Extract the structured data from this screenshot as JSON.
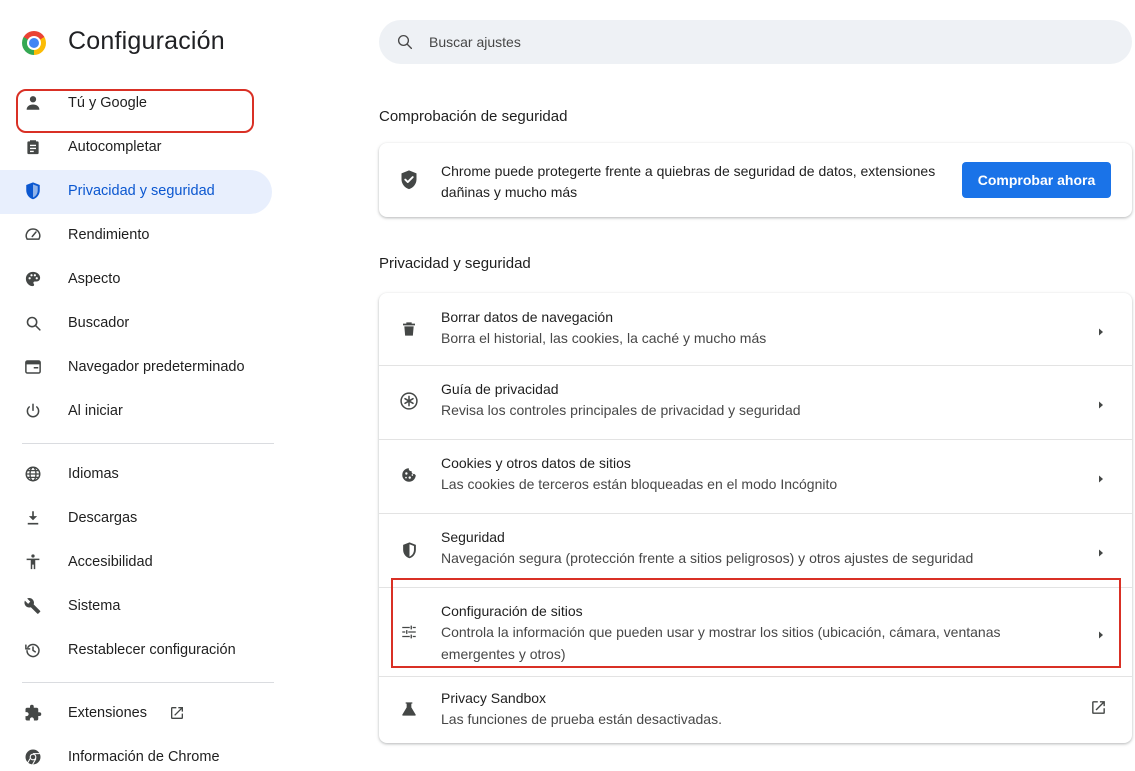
{
  "app": {
    "title": "Configuración"
  },
  "search": {
    "placeholder": "Buscar ajustes",
    "value": ""
  },
  "sidebar": {
    "items": [
      {
        "label": "Tú y Google",
        "icon": "person-icon"
      },
      {
        "label": "Autocompletar",
        "icon": "clipboard-icon"
      },
      {
        "label": "Privacidad y seguridad",
        "icon": "shield-icon",
        "active": true
      },
      {
        "label": "Rendimiento",
        "icon": "speedometer-icon"
      },
      {
        "label": "Aspecto",
        "icon": "palette-icon"
      },
      {
        "label": "Buscador",
        "icon": "search-icon"
      },
      {
        "label": "Navegador predeterminado",
        "icon": "browser-window-icon"
      },
      {
        "label": "Al iniciar",
        "icon": "power-icon"
      },
      {
        "label": "Idiomas",
        "icon": "globe-icon"
      },
      {
        "label": "Descargas",
        "icon": "download-icon"
      },
      {
        "label": "Accesibilidad",
        "icon": "accessibility-icon"
      },
      {
        "label": "Sistema",
        "icon": "wrench-icon"
      },
      {
        "label": "Restablecer configuración",
        "icon": "restore-icon"
      },
      {
        "label": "Extensiones",
        "icon": "puzzle-icon"
      },
      {
        "label": "Información de Chrome",
        "icon": "chrome-icon"
      }
    ]
  },
  "safety_check": {
    "section_title": "Comprobación de seguridad",
    "description": "Chrome puede protegerte frente a quiebras de seguridad de datos, extensiones dañinas y mucho más",
    "button_label": "Comprobar ahora"
  },
  "privacy": {
    "section_title": "Privacidad y seguridad",
    "rows": [
      {
        "title": "Borrar datos de navegación",
        "subtitle": "Borra el historial, las cookies, la caché y mucho más",
        "icon": "trash-icon"
      },
      {
        "title": "Guía de privacidad",
        "subtitle": "Revisa los controles principales de privacidad y seguridad",
        "icon": "privacy-guide-icon"
      },
      {
        "title": "Cookies y otros datos de sitios",
        "subtitle": "Las cookies de terceros están bloqueadas en el modo Incógnito",
        "icon": "cookie-icon"
      },
      {
        "title": "Seguridad",
        "subtitle": "Navegación segura (protección frente a sitios peligrosos) y otros ajustes de seguridad",
        "icon": "security-shield-icon"
      },
      {
        "title": "Configuración de sitios",
        "subtitle": "Controla la información que pueden usar y mostrar los sitios (ubicación, cámara, ventanas emergentes y otros)",
        "icon": "tune-icon"
      },
      {
        "title": "Privacy Sandbox",
        "subtitle": "Las funciones de prueba están desactivadas.",
        "icon": "flask-icon"
      }
    ]
  },
  "colors": {
    "accent": "#1a73e8",
    "active_bg": "#e8effd",
    "highlight": "#d93025"
  }
}
